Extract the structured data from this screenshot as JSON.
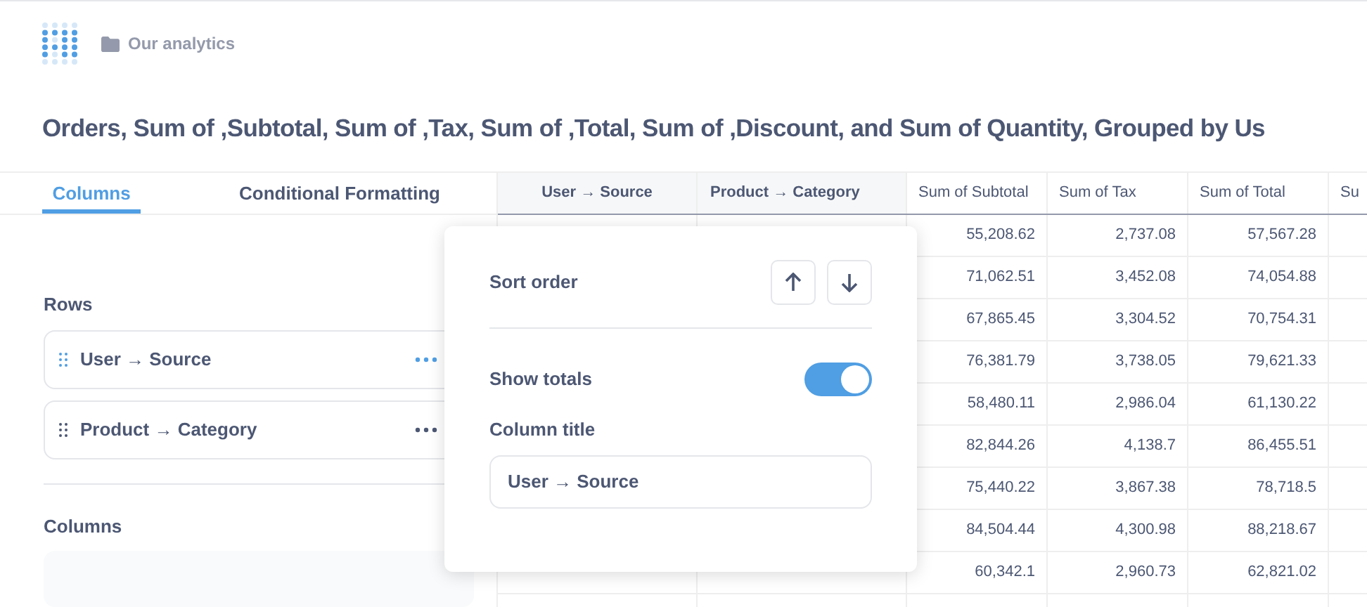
{
  "breadcrumb": {
    "collection": "Our analytics"
  },
  "title": "Orders, Sum of ,Subtotal, Sum of ,Tax, Sum of ,Total, Sum of ,Discount, and Sum of Quantity, Grouped by Us",
  "tabs": [
    {
      "label": "Columns",
      "selected": true
    },
    {
      "label": "Conditional Formatting",
      "selected": false
    }
  ],
  "rows_section": {
    "heading": "Rows",
    "fields": [
      {
        "label": "User → Source",
        "active": true
      },
      {
        "label": "Product → Category",
        "active": false
      }
    ]
  },
  "columns_section": {
    "heading": "Columns"
  },
  "table": {
    "columns": [
      "User → Source",
      "Product → Category",
      "Sum of Subtotal",
      "Sum of Tax",
      "Sum of Total",
      "Su"
    ],
    "rows": [
      {
        "values": [
          "55,208.62",
          "2,737.08",
          "57,567.28"
        ]
      },
      {
        "values": [
          "71,062.51",
          "3,452.08",
          "74,054.88"
        ]
      },
      {
        "values": [
          "67,865.45",
          "3,304.52",
          "70,754.31"
        ]
      },
      {
        "values": [
          "76,381.79",
          "3,738.05",
          "79,621.33"
        ]
      },
      {
        "values": [
          "58,480.11",
          "2,986.04",
          "61,130.22"
        ]
      },
      {
        "values": [
          "82,844.26",
          "4,138.7",
          "86,455.51"
        ]
      },
      {
        "values": [
          "75,440.22",
          "3,867.38",
          "78,718.5"
        ]
      },
      {
        "values": [
          "84,504.44",
          "4,300.98",
          "88,218.67"
        ]
      },
      {
        "values": [
          "60,342.1",
          "2,960.73",
          "62,821.02"
        ]
      }
    ]
  },
  "popover": {
    "sort_label": "Sort order",
    "totals_label": "Show totals",
    "totals_on": true,
    "column_title_label": "Column title",
    "column_title_value": "User → Source"
  }
}
